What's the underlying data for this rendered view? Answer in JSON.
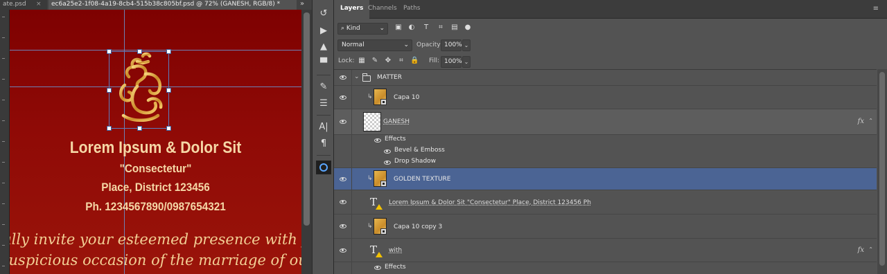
{
  "document_tabs": [
    {
      "label": "ate.psd",
      "close": "×"
    },
    {
      "label": "ec6a25e2-1f08-4a19-8cb4-515b38c805bf.psd @ 72% (GANESH, RGB/8) *"
    }
  ],
  "tabs_overflow": "»",
  "canvas": {
    "title": "Lorem Ipsum & Dolor Sit",
    "subtitle": "\"Consectetur\"",
    "place": "Place, District 123456",
    "phone": "Ph. 1234567890/0987654321",
    "script_line_1": "dially invite your esteemed presence with fam",
    "script_line_2": "auspicious occasion of the marriage of our d"
  },
  "tools": [
    {
      "name": "history-icon",
      "glyph": "↺"
    },
    {
      "name": "play-icon",
      "glyph": "▶"
    },
    {
      "name": "brush-presets-icon",
      "glyph": "▲"
    },
    {
      "name": "comment-icon",
      "glyph": "▀"
    },
    {
      "name": "brush-settings-icon",
      "glyph": "✎"
    },
    {
      "name": "adjustments-icon",
      "glyph": "☰"
    },
    {
      "name": "character-icon",
      "glyph": "A|"
    },
    {
      "name": "paragraph-icon",
      "glyph": "¶"
    }
  ],
  "panel": {
    "tabs": [
      "Layers",
      "Channels",
      "Paths"
    ],
    "filter_kind": "Kind",
    "blend_mode": "Normal",
    "opacity_label": "Opacity:",
    "opacity_value": "100%",
    "lock_label": "Lock:",
    "fill_label": "Fill:",
    "fill_value": "100%"
  },
  "layers": [
    {
      "name": "MATTER",
      "type": "group"
    },
    {
      "name": "Capa 10",
      "type": "smart-object",
      "clipped": true
    },
    {
      "name": "GANESH",
      "type": "raster",
      "fx": "fx"
    },
    {
      "name": "Effects",
      "type": "effects-header"
    },
    {
      "name": "Bevel & Emboss",
      "type": "effect"
    },
    {
      "name": "Drop Shadow",
      "type": "effect"
    },
    {
      "name": "GOLDEN TEXTURE",
      "type": "smart-object",
      "clipped": true,
      "selected": true
    },
    {
      "name": "Lorem Ipsum & Dolor Sit \"Consectetur\" Place, District 123456 Ph",
      "type": "text"
    },
    {
      "name": "Capa 10 copy 3",
      "type": "smart-object",
      "clipped": true
    },
    {
      "name": "with",
      "type": "text",
      "fx": "fx"
    },
    {
      "name": "Effects",
      "type": "effects-header"
    }
  ],
  "colors": {
    "canvas_red": "#8f0a06",
    "gold_text": "#f5d7a6",
    "selection_blue": "#4b6494",
    "warning_yellow": "#f3c200"
  }
}
